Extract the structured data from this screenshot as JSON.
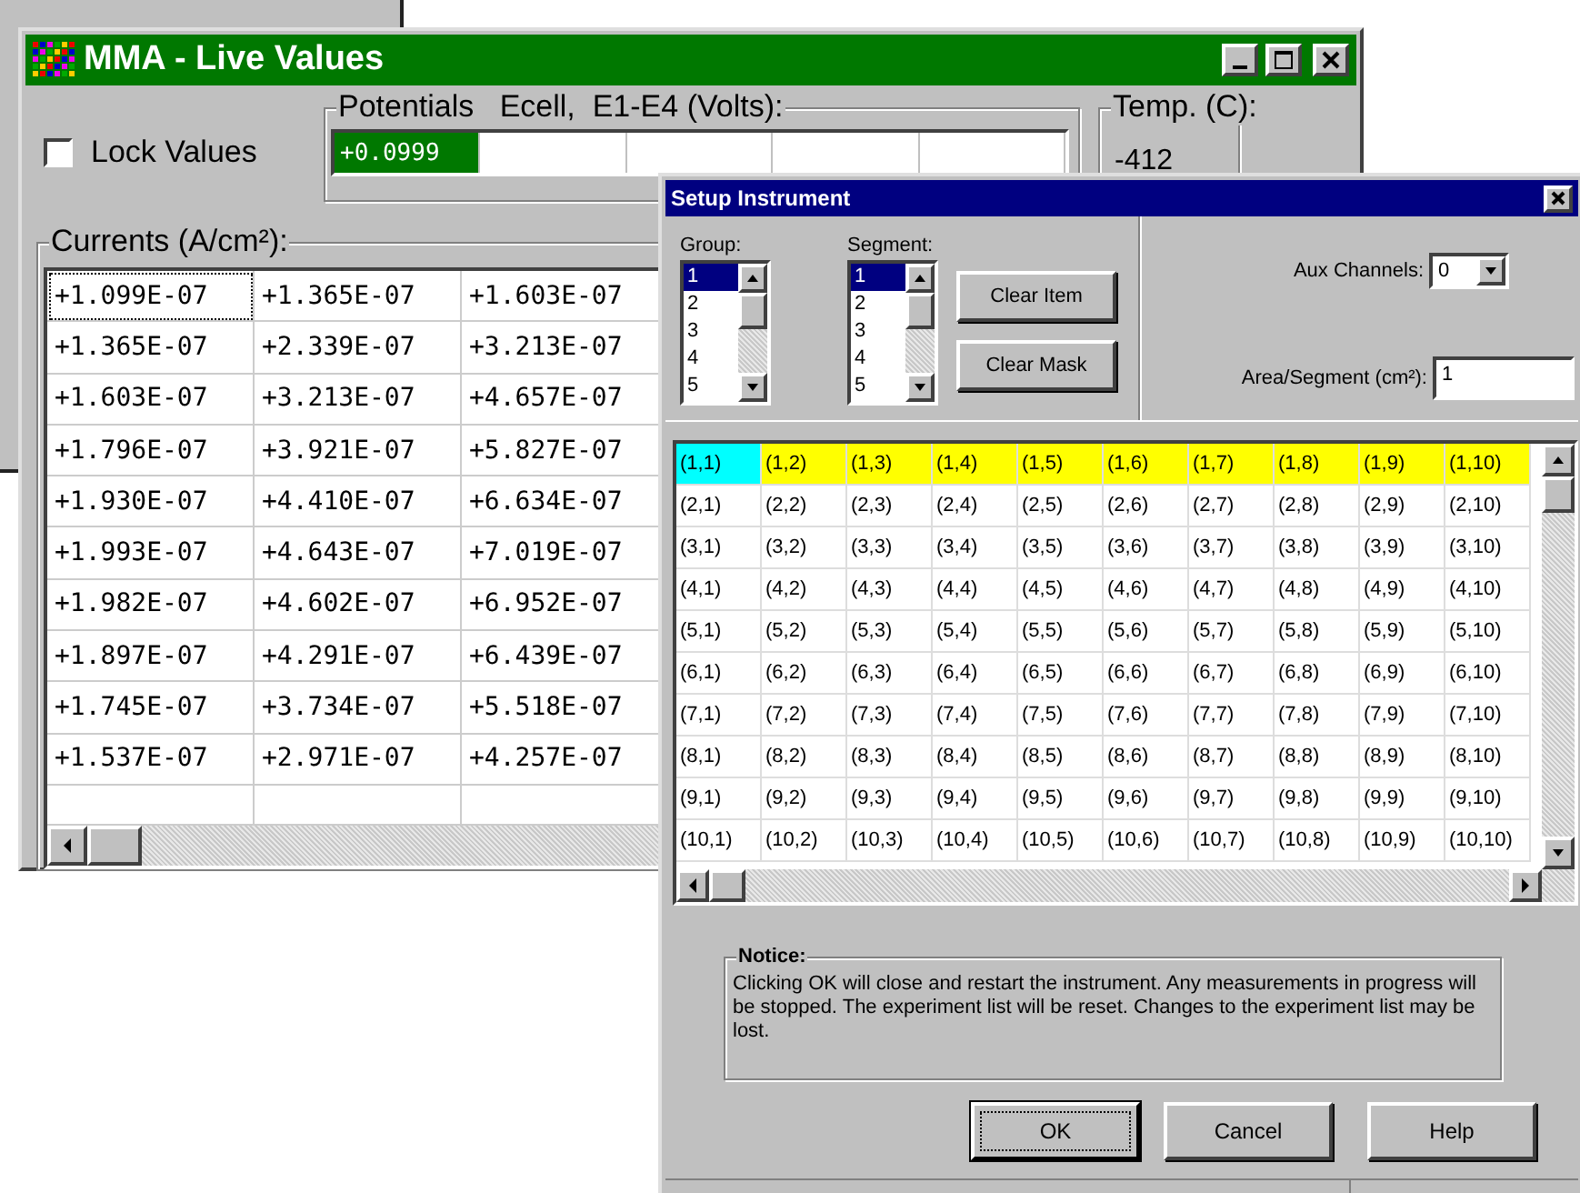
{
  "live_window": {
    "title": "MMA - Live Values",
    "lock_values": {
      "label": "Lock Values",
      "checked": false
    },
    "potentials": {
      "label": "Potentials   Ecell,  E1-E4 (Volts):",
      "cells": [
        {
          "value": "+0.0999",
          "selected": true
        }
      ]
    },
    "temperature": {
      "label": "Temp. (C):",
      "value": "-412"
    },
    "currents": {
      "label": "Currents (A/cm²):",
      "rows": [
        [
          {
            "text": "+1.099E-07",
            "focused": true
          },
          {
            "text": "+1.365E-07",
            "focused": false
          },
          {
            "text": "+1.603E-07",
            "focused": false
          }
        ],
        [
          {
            "text": "+1.365E-07",
            "focused": false
          },
          {
            "text": "+2.339E-07",
            "focused": false
          },
          {
            "text": "+3.213E-07",
            "focused": false
          }
        ],
        [
          {
            "text": "+1.603E-07",
            "focused": false
          },
          {
            "text": "+3.213E-07",
            "focused": false
          },
          {
            "text": "+4.657E-07",
            "focused": false
          }
        ],
        [
          {
            "text": "+1.796E-07",
            "focused": false
          },
          {
            "text": "+3.921E-07",
            "focused": false
          },
          {
            "text": "+5.827E-07",
            "focused": false
          }
        ],
        [
          {
            "text": "+1.930E-07",
            "focused": false
          },
          {
            "text": "+4.410E-07",
            "focused": false
          },
          {
            "text": "+6.634E-07",
            "focused": false
          }
        ],
        [
          {
            "text": "+1.993E-07",
            "focused": false
          },
          {
            "text": "+4.643E-07",
            "focused": false
          },
          {
            "text": "+7.019E-07",
            "focused": false
          }
        ],
        [
          {
            "text": "+1.982E-07",
            "focused": false
          },
          {
            "text": "+4.602E-07",
            "focused": false
          },
          {
            "text": "+6.952E-07",
            "focused": false
          }
        ],
        [
          {
            "text": "+1.897E-07",
            "focused": false
          },
          {
            "text": "+4.291E-07",
            "focused": false
          },
          {
            "text": "+6.439E-07",
            "focused": false
          }
        ],
        [
          {
            "text": "+1.745E-07",
            "focused": false
          },
          {
            "text": "+3.734E-07",
            "focused": false
          },
          {
            "text": "+5.518E-07",
            "focused": false
          }
        ],
        [
          {
            "text": "+1.537E-07",
            "focused": false
          },
          {
            "text": "+2.971E-07",
            "focused": false
          },
          {
            "text": "+4.257E-07",
            "focused": false
          }
        ]
      ]
    }
  },
  "setup_dialog": {
    "title": "Setup Instrument",
    "group": {
      "label": "Group:",
      "items": [
        {
          "text": "1",
          "selected": true
        },
        {
          "text": "2",
          "selected": false
        },
        {
          "text": "3",
          "selected": false
        },
        {
          "text": "4",
          "selected": false
        },
        {
          "text": "5",
          "selected": false
        }
      ]
    },
    "segment": {
      "label": "Segment:",
      "items": [
        {
          "text": "1",
          "selected": true
        },
        {
          "text": "2",
          "selected": false
        },
        {
          "text": "3",
          "selected": false
        },
        {
          "text": "4",
          "selected": false
        },
        {
          "text": "5",
          "selected": false
        }
      ]
    },
    "side_buttons": [
      "Clear Item",
      "Clear Mask"
    ],
    "aux_channels": {
      "label": "Aux Channels:",
      "value": "0"
    },
    "area": {
      "label": "Area/Segment (cm²):",
      "value": "1"
    },
    "grid": {
      "rows": [
        {
          "highlighted": true,
          "cells": [
            {
              "text": "(1,1)",
              "selected": true
            },
            {
              "text": "(1,2)",
              "selected": false
            },
            {
              "text": "(1,3)",
              "selected": false
            },
            {
              "text": "(1,4)",
              "selected": false
            },
            {
              "text": "(1,5)",
              "selected": false
            },
            {
              "text": "(1,6)",
              "selected": false
            },
            {
              "text": "(1,7)",
              "selected": false
            },
            {
              "text": "(1,8)",
              "selected": false
            },
            {
              "text": "(1,9)",
              "selected": false
            },
            {
              "text": "(1,10)",
              "selected": false
            }
          ]
        },
        {
          "highlighted": false,
          "cells": [
            {
              "text": "(2,1)",
              "selected": false
            },
            {
              "text": "(2,2)",
              "selected": false
            },
            {
              "text": "(2,3)",
              "selected": false
            },
            {
              "text": "(2,4)",
              "selected": false
            },
            {
              "text": "(2,5)",
              "selected": false
            },
            {
              "text": "(2,6)",
              "selected": false
            },
            {
              "text": "(2,7)",
              "selected": false
            },
            {
              "text": "(2,8)",
              "selected": false
            },
            {
              "text": "(2,9)",
              "selected": false
            },
            {
              "text": "(2,10)",
              "selected": false
            }
          ]
        },
        {
          "highlighted": false,
          "cells": [
            {
              "text": "(3,1)",
              "selected": false
            },
            {
              "text": "(3,2)",
              "selected": false
            },
            {
              "text": "(3,3)",
              "selected": false
            },
            {
              "text": "(3,4)",
              "selected": false
            },
            {
              "text": "(3,5)",
              "selected": false
            },
            {
              "text": "(3,6)",
              "selected": false
            },
            {
              "text": "(3,7)",
              "selected": false
            },
            {
              "text": "(3,8)",
              "selected": false
            },
            {
              "text": "(3,9)",
              "selected": false
            },
            {
              "text": "(3,10)",
              "selected": false
            }
          ]
        },
        {
          "highlighted": false,
          "cells": [
            {
              "text": "(4,1)",
              "selected": false
            },
            {
              "text": "(4,2)",
              "selected": false
            },
            {
              "text": "(4,3)",
              "selected": false
            },
            {
              "text": "(4,4)",
              "selected": false
            },
            {
              "text": "(4,5)",
              "selected": false
            },
            {
              "text": "(4,6)",
              "selected": false
            },
            {
              "text": "(4,7)",
              "selected": false
            },
            {
              "text": "(4,8)",
              "selected": false
            },
            {
              "text": "(4,9)",
              "selected": false
            },
            {
              "text": "(4,10)",
              "selected": false
            }
          ]
        },
        {
          "highlighted": false,
          "cells": [
            {
              "text": "(5,1)",
              "selected": false
            },
            {
              "text": "(5,2)",
              "selected": false
            },
            {
              "text": "(5,3)",
              "selected": false
            },
            {
              "text": "(5,4)",
              "selected": false
            },
            {
              "text": "(5,5)",
              "selected": false
            },
            {
              "text": "(5,6)",
              "selected": false
            },
            {
              "text": "(5,7)",
              "selected": false
            },
            {
              "text": "(5,8)",
              "selected": false
            },
            {
              "text": "(5,9)",
              "selected": false
            },
            {
              "text": "(5,10)",
              "selected": false
            }
          ]
        },
        {
          "highlighted": false,
          "cells": [
            {
              "text": "(6,1)",
              "selected": false
            },
            {
              "text": "(6,2)",
              "selected": false
            },
            {
              "text": "(6,3)",
              "selected": false
            },
            {
              "text": "(6,4)",
              "selected": false
            },
            {
              "text": "(6,5)",
              "selected": false
            },
            {
              "text": "(6,6)",
              "selected": false
            },
            {
              "text": "(6,7)",
              "selected": false
            },
            {
              "text": "(6,8)",
              "selected": false
            },
            {
              "text": "(6,9)",
              "selected": false
            },
            {
              "text": "(6,10)",
              "selected": false
            }
          ]
        },
        {
          "highlighted": false,
          "cells": [
            {
              "text": "(7,1)",
              "selected": false
            },
            {
              "text": "(7,2)",
              "selected": false
            },
            {
              "text": "(7,3)",
              "selected": false
            },
            {
              "text": "(7,4)",
              "selected": false
            },
            {
              "text": "(7,5)",
              "selected": false
            },
            {
              "text": "(7,6)",
              "selected": false
            },
            {
              "text": "(7,7)",
              "selected": false
            },
            {
              "text": "(7,8)",
              "selected": false
            },
            {
              "text": "(7,9)",
              "selected": false
            },
            {
              "text": "(7,10)",
              "selected": false
            }
          ]
        },
        {
          "highlighted": false,
          "cells": [
            {
              "text": "(8,1)",
              "selected": false
            },
            {
              "text": "(8,2)",
              "selected": false
            },
            {
              "text": "(8,3)",
              "selected": false
            },
            {
              "text": "(8,4)",
              "selected": false
            },
            {
              "text": "(8,5)",
              "selected": false
            },
            {
              "text": "(8,6)",
              "selected": false
            },
            {
              "text": "(8,7)",
              "selected": false
            },
            {
              "text": "(8,8)",
              "selected": false
            },
            {
              "text": "(8,9)",
              "selected": false
            },
            {
              "text": "(8,10)",
              "selected": false
            }
          ]
        },
        {
          "highlighted": false,
          "cells": [
            {
              "text": "(9,1)",
              "selected": false
            },
            {
              "text": "(9,2)",
              "selected": false
            },
            {
              "text": "(9,3)",
              "selected": false
            },
            {
              "text": "(9,4)",
              "selected": false
            },
            {
              "text": "(9,5)",
              "selected": false
            },
            {
              "text": "(9,6)",
              "selected": false
            },
            {
              "text": "(9,7)",
              "selected": false
            },
            {
              "text": "(9,8)",
              "selected": false
            },
            {
              "text": "(9,9)",
              "selected": false
            },
            {
              "text": "(9,10)",
              "selected": false
            }
          ]
        },
        {
          "highlighted": false,
          "cells": [
            {
              "text": "(10,1)",
              "selected": false
            },
            {
              "text": "(10,2)",
              "selected": false
            },
            {
              "text": "(10,3)",
              "selected": false
            },
            {
              "text": "(10,4)",
              "selected": false
            },
            {
              "text": "(10,5)",
              "selected": false
            },
            {
              "text": "(10,6)",
              "selected": false
            },
            {
              "text": "(10,7)",
              "selected": false
            },
            {
              "text": "(10,8)",
              "selected": false
            },
            {
              "text": "(10,9)",
              "selected": false
            },
            {
              "text": "(10,10)",
              "selected": false
            }
          ]
        }
      ]
    },
    "notice": {
      "label": "Notice:",
      "text": "Clicking OK will close and restart the instrument. Any measurements in progress will be stopped. The experiment list will be reset. Changes to the experiment list may be lost."
    },
    "buttons": [
      {
        "label": "OK",
        "focused": true
      },
      {
        "label": "Cancel",
        "focused": false
      },
      {
        "label": "Help",
        "focused": false
      }
    ]
  }
}
